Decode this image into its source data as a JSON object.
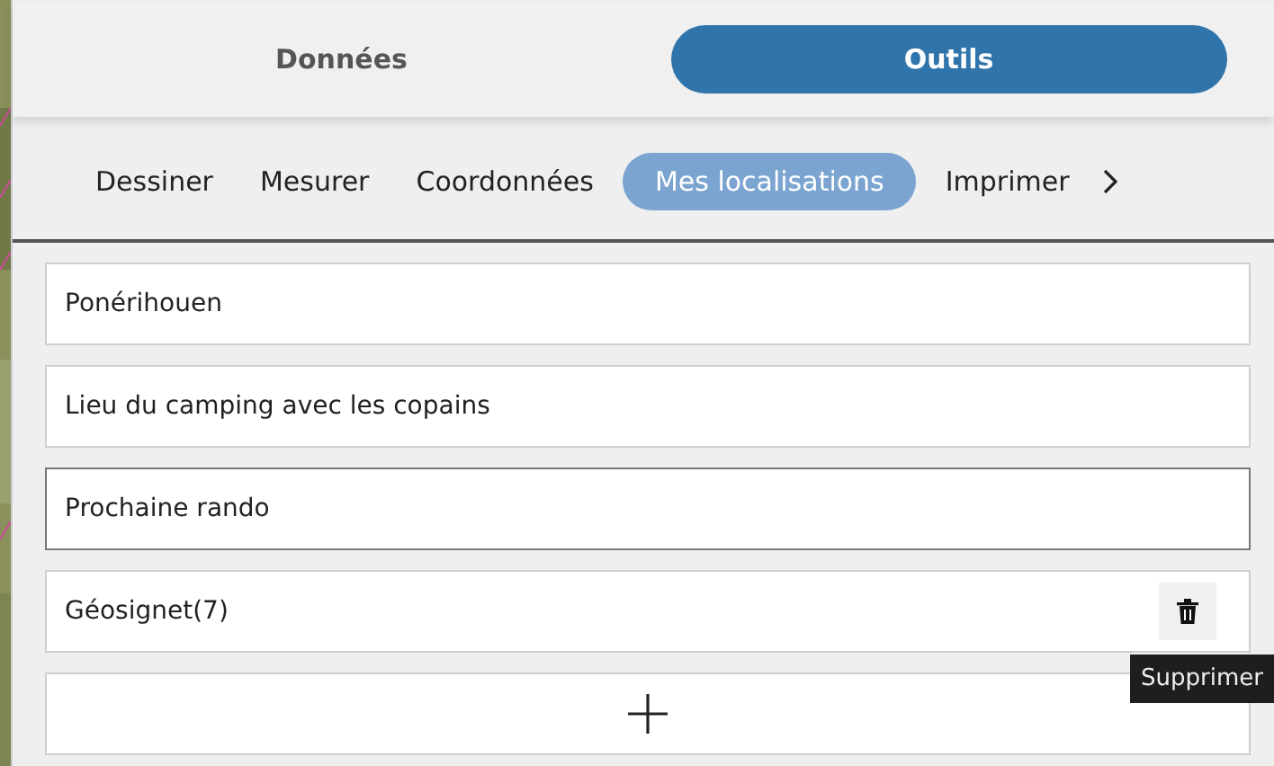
{
  "main_tabs": [
    {
      "label": "Données",
      "selected": false
    },
    {
      "label": "Outils",
      "selected": true
    }
  ],
  "sub_tabs": [
    {
      "label": "Dessiner",
      "selected": false
    },
    {
      "label": "Mesurer",
      "selected": false
    },
    {
      "label": "Coordonnées",
      "selected": false
    },
    {
      "label": "Mes localisations",
      "selected": true
    },
    {
      "label": "Imprimer",
      "selected": false
    }
  ],
  "locations": [
    {
      "name": "Ponérihouen",
      "focused": false,
      "hovered": false
    },
    {
      "name": "Lieu du camping avec les copains",
      "focused": false,
      "hovered": false
    },
    {
      "name": "Prochaine rando",
      "focused": true,
      "hovered": false
    },
    {
      "name": "Géosignet(7)",
      "focused": false,
      "hovered": true
    }
  ],
  "tooltip": "Supprimer"
}
